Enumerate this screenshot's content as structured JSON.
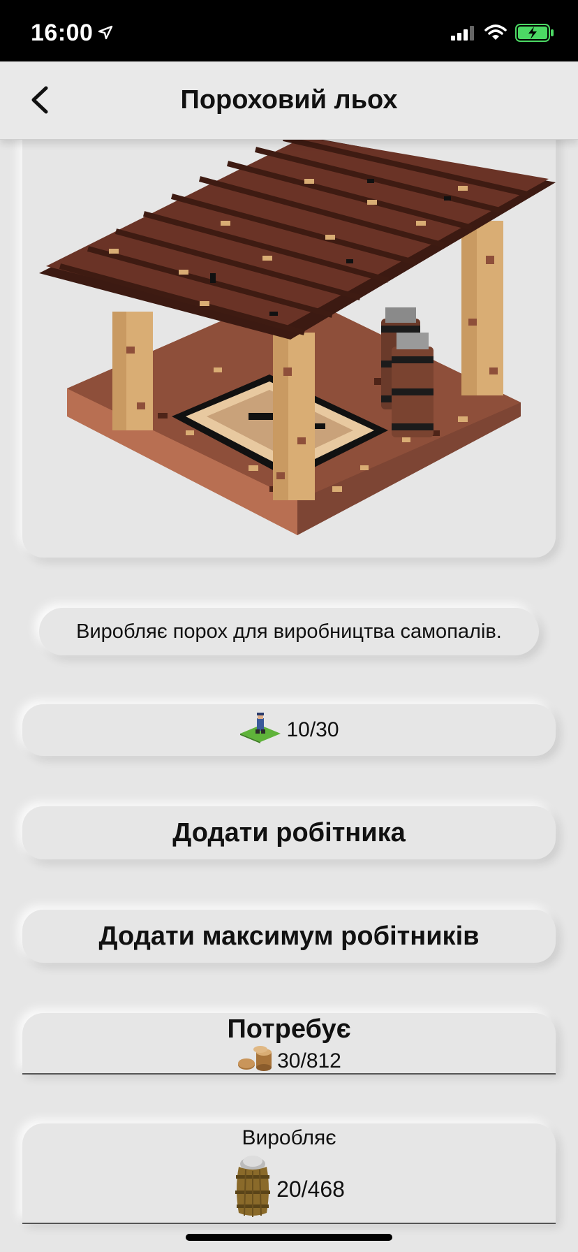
{
  "status": {
    "time": "16:00",
    "icons": [
      "location-arrow-icon",
      "signal-icon",
      "wifi-icon",
      "battery-charging-icon"
    ]
  },
  "nav": {
    "title": "Пороховий льох",
    "back_icon": "chevron-left-icon"
  },
  "building": {
    "image": "powder-cellar-voxel-image",
    "description": "Виробляє порох для виробництва самопалів."
  },
  "workers": {
    "icon": "worker-tile-icon",
    "value": "10/30"
  },
  "buttons": {
    "add_worker": "Додати робітника",
    "add_max_workers": "Додати максимум робітників"
  },
  "requires": {
    "title": "Потребує",
    "icon": "coins-icon",
    "value": "30/812"
  },
  "produces": {
    "title": "Виробляє",
    "icon": "powder-barrel-icon",
    "value": "20/468"
  },
  "colors": {
    "background": "#e6e6e6",
    "wood_dark": "#5a2f22",
    "wood_light": "#d9ad74",
    "battery_green": "#4cd964"
  }
}
